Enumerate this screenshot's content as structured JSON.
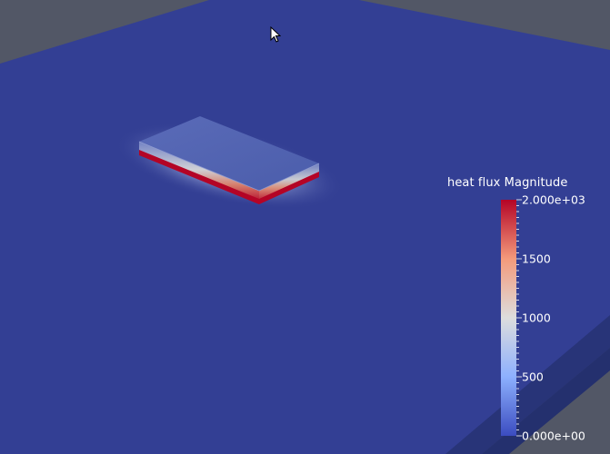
{
  "colorbar": {
    "title": "heat flux Magnitude",
    "range": [
      0,
      2000
    ],
    "labels": [
      {
        "value": 2000,
        "text": "2.000e+03"
      },
      {
        "value": 1500,
        "text": "1500"
      },
      {
        "value": 1000,
        "text": "1000"
      },
      {
        "value": 500,
        "text": "500"
      },
      {
        "value": 0,
        "text": "0.000e+00"
      }
    ],
    "colors": {
      "low": "#3b4cc0",
      "mid": "#dddddd",
      "high": "#b40426"
    }
  },
  "scene": {
    "background_color": "#525766",
    "ground_color": "#333f94",
    "plate_color": "#4a5fae",
    "plate_hot_edge_color": "#b40426"
  },
  "cursor": {
    "icon": "arrow-pointer-icon"
  }
}
